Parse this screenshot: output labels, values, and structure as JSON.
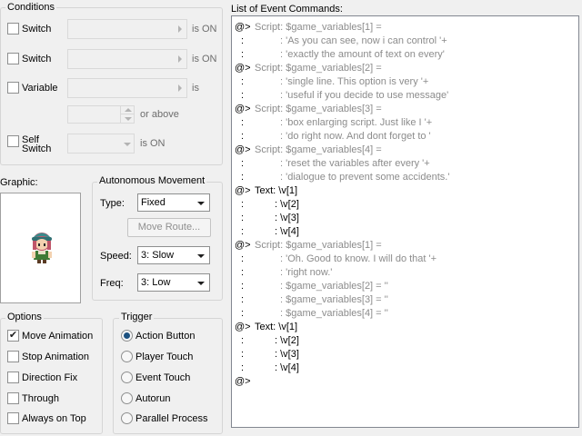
{
  "conditions": {
    "title": "Conditions",
    "switch1": {
      "label": "Switch",
      "suffix": "is ON"
    },
    "switch2": {
      "label": "Switch",
      "suffix": "is ON"
    },
    "variable": {
      "label": "Variable",
      "suffix": "is",
      "or_above": "or above"
    },
    "self_switch": {
      "label_line1": "Self",
      "label_line2": "Switch",
      "suffix": "is ON"
    }
  },
  "graphic": {
    "title": "Graphic:"
  },
  "autonomous": {
    "title": "Autonomous Movement",
    "type_label": "Type:",
    "type_value": "Fixed",
    "move_route_label": "Move Route...",
    "speed_label": "Speed:",
    "speed_value": "3: Slow",
    "freq_label": "Freq:",
    "freq_value": "3: Low"
  },
  "options": {
    "title": "Options",
    "items": [
      {
        "label": "Move Animation",
        "checked": true
      },
      {
        "label": "Stop Animation",
        "checked": false
      },
      {
        "label": "Direction Fix",
        "checked": false
      },
      {
        "label": "Through",
        "checked": false
      },
      {
        "label": "Always on Top",
        "checked": false
      }
    ]
  },
  "trigger": {
    "title": "Trigger",
    "items": [
      {
        "label": "Action Button",
        "selected": true
      },
      {
        "label": "Player Touch",
        "selected": false
      },
      {
        "label": "Event Touch",
        "selected": false
      },
      {
        "label": "Autorun",
        "selected": false
      },
      {
        "label": "Parallel Process",
        "selected": false
      }
    ]
  },
  "event_commands": {
    "title": "List of Event Commands:",
    "lines": [
      {
        "prefix": "@>",
        "content": "Script: $game_variables[1] =",
        "kind": "script",
        "indent": 0
      },
      {
        "prefix": ":",
        "content": ": 'As you can see, now i can control '+",
        "kind": "script",
        "indent": 1
      },
      {
        "prefix": ":",
        "content": ": 'exactly the amount of text on every'",
        "kind": "script",
        "indent": 1
      },
      {
        "prefix": "@>",
        "content": "Script: $game_variables[2] =",
        "kind": "script",
        "indent": 0
      },
      {
        "prefix": ":",
        "content": ": 'single line. This option is very '+",
        "kind": "script",
        "indent": 1
      },
      {
        "prefix": ":",
        "content": ": 'useful if you decide to use message'",
        "kind": "script",
        "indent": 1
      },
      {
        "prefix": "@>",
        "content": "Script: $game_variables[3] =",
        "kind": "script",
        "indent": 0
      },
      {
        "prefix": ":",
        "content": ": 'box enlarging script. Just like I '+",
        "kind": "script",
        "indent": 1
      },
      {
        "prefix": ":",
        "content": ": 'do right now. And dont forget to '",
        "kind": "script",
        "indent": 1
      },
      {
        "prefix": "@>",
        "content": "Script: $game_variables[4] =",
        "kind": "script",
        "indent": 0
      },
      {
        "prefix": ":",
        "content": ": 'reset the variables after every '+",
        "kind": "script",
        "indent": 1
      },
      {
        "prefix": ":",
        "content": ": 'dialogue to prevent some accidents.'",
        "kind": "script",
        "indent": 1
      },
      {
        "prefix": "@>",
        "content": "Text: \\v[1]",
        "kind": "text",
        "indent": 0
      },
      {
        "prefix": ":",
        "content": ": \\v[2]",
        "kind": "text",
        "indent": 2
      },
      {
        "prefix": ":",
        "content": ": \\v[3]",
        "kind": "text",
        "indent": 2
      },
      {
        "prefix": ":",
        "content": ": \\v[4]",
        "kind": "text",
        "indent": 2
      },
      {
        "prefix": "@>",
        "content": "Script: $game_variables[1] =",
        "kind": "script",
        "indent": 0
      },
      {
        "prefix": ":",
        "content": ": 'Oh. Good to know. I will do that '+",
        "kind": "script",
        "indent": 1
      },
      {
        "prefix": ":",
        "content": ": 'right now.'",
        "kind": "script",
        "indent": 1
      },
      {
        "prefix": ":",
        "content": ": $game_variables[2] = ''",
        "kind": "script",
        "indent": 1
      },
      {
        "prefix": ":",
        "content": ": $game_variables[3] = ''",
        "kind": "script",
        "indent": 1
      },
      {
        "prefix": ":",
        "content": ": $game_variables[4] = ''",
        "kind": "script",
        "indent": 1
      },
      {
        "prefix": "@>",
        "content": "Text: \\v[1]",
        "kind": "text",
        "indent": 0
      },
      {
        "prefix": ":",
        "content": ": \\v[2]",
        "kind": "text",
        "indent": 2
      },
      {
        "prefix": ":",
        "content": ": \\v[3]",
        "kind": "text",
        "indent": 2
      },
      {
        "prefix": ":",
        "content": ": \\v[4]",
        "kind": "text",
        "indent": 2
      },
      {
        "prefix": "@>",
        "content": "",
        "kind": "text",
        "indent": 0
      }
    ]
  },
  "colors": {
    "script_text": "#8c8c8c",
    "normal_text": "#000000",
    "radio_selected": "#1c5180"
  }
}
